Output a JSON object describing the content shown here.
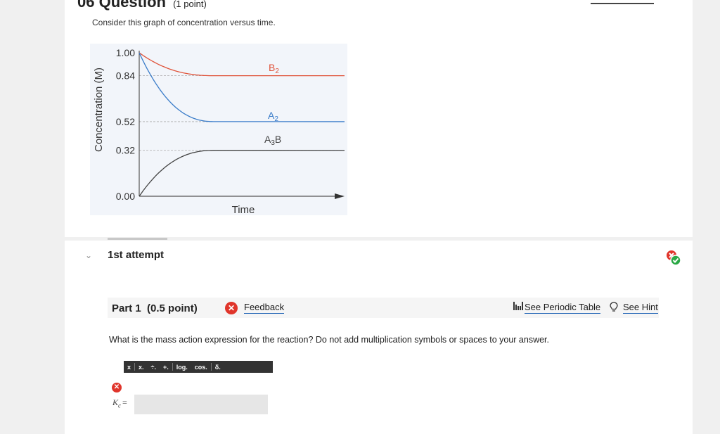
{
  "question": {
    "number": "06",
    "title": "Question",
    "points": "(1 point)",
    "prompt": "Consider this graph of concentration versus time."
  },
  "chart_data": {
    "type": "line",
    "xlabel": "Time",
    "ylabel": "Concentration (M)",
    "yticks": [
      "1.00",
      "0.84",
      "0.52",
      "0.32",
      "0.00"
    ],
    "ylim": [
      0,
      1.0
    ],
    "series": [
      {
        "name": "B2",
        "color": "#e0533a",
        "start": 1.0,
        "end": 0.84
      },
      {
        "name": "A2",
        "color": "#3a7cc9",
        "start": 1.0,
        "end": 0.52
      },
      {
        "name": "A3B",
        "color": "#444444",
        "start": 0.0,
        "end": 0.32
      }
    ],
    "labels": {
      "b2": "B",
      "b2_sub": "2",
      "a2": "A",
      "a2_sub": "2",
      "a3b_a": "A",
      "a3b_sub": "3",
      "a3b_b": "B"
    }
  },
  "attempt": {
    "label": "1st attempt"
  },
  "part": {
    "title": "Part 1",
    "points": "(0.5 point)",
    "feedback_label": "Feedback",
    "periodic_label": "See Periodic Table",
    "hint_label": "See Hint"
  },
  "prompt2": "What is the mass action expression for the reaction? Do not add multiplication symbols or spaces to your answer.",
  "toolbar": [
    "x",
    "x.",
    "÷.",
    "+.",
    "log.",
    "cos.",
    "δ."
  ],
  "answer": {
    "label_k": "K",
    "label_sub": "c",
    "label_eq": "=",
    "value": ""
  },
  "colors": {
    "error": "#e0352b",
    "success": "#2aa845"
  }
}
